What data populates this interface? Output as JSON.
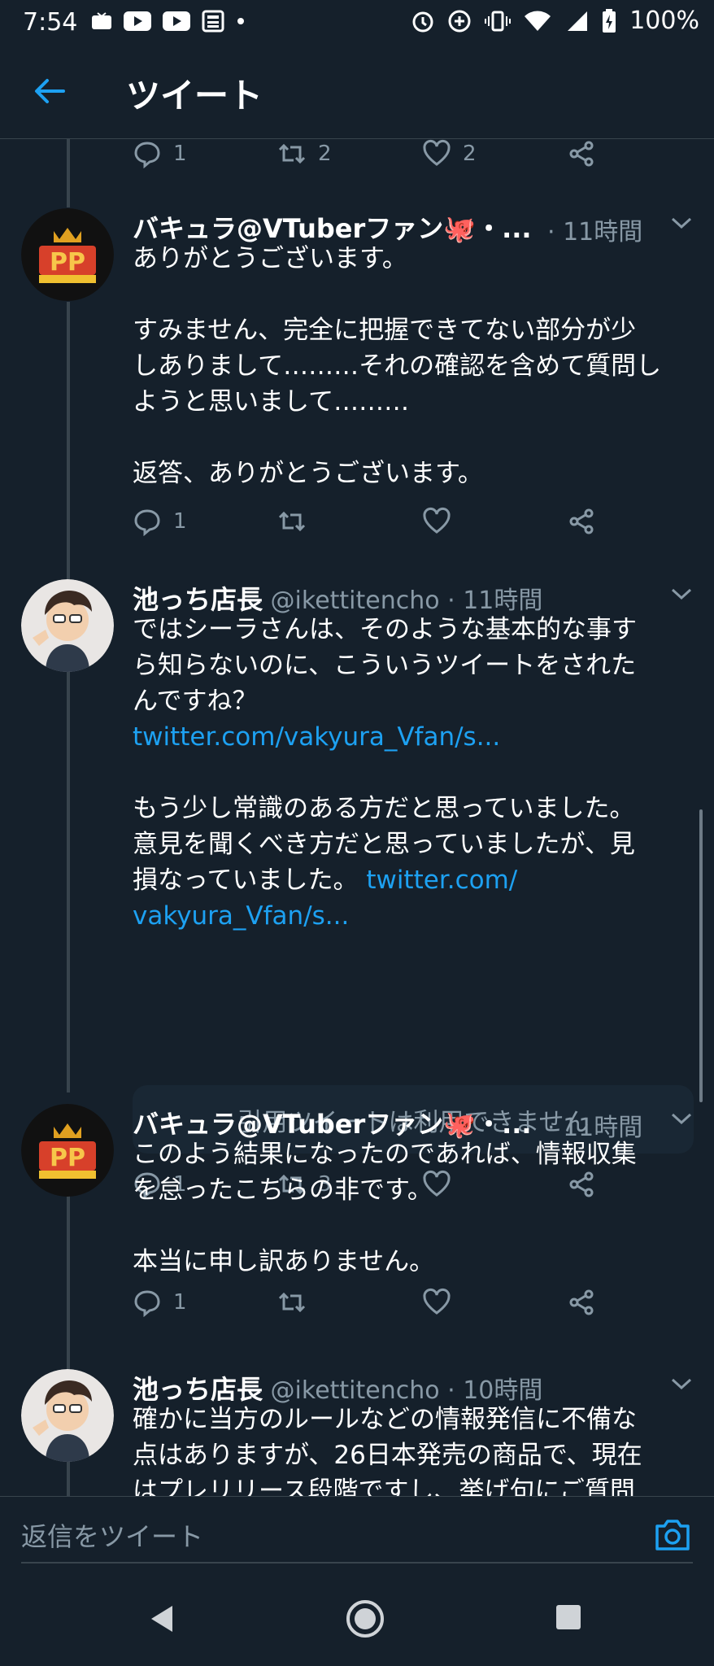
{
  "status_bar": {
    "time": "7:54",
    "battery": "100%",
    "left_icons": [
      "tv-icon",
      "youtube-icon",
      "youtube-icon",
      "news-icon",
      "dot-icon"
    ],
    "right_icons": [
      "alarm-icon",
      "data-saver-icon",
      "vibrate-icon",
      "wifi-icon",
      "signal-icon",
      "battery-icon"
    ]
  },
  "app_bar": {
    "title": "ツイート",
    "back_icon": "arrow-left-icon"
  },
  "colors": {
    "background": "#15202b",
    "accent": "#1da1f2",
    "muted": "#8899a6",
    "divider": "#38444d"
  },
  "top_actions": {
    "reply_count": "1",
    "retweet_count": "2",
    "like_count": "2"
  },
  "tweets": [
    {
      "name": "バキュラ@VTuberファン🐙・...",
      "meta": " · 11時間",
      "lines": [
        "ありがとうございます。",
        "",
        "すみません、完全に把握できてない部分が少",
        "しありまして………それの確認を含めて質問し",
        "ようと思いまして………",
        "",
        "返答、ありがとうございます。"
      ],
      "reply_count": "1",
      "retweet_count": "",
      "like_count": ""
    },
    {
      "name": "池っち店長",
      "meta": " @ikettitencho · 11時間",
      "lines": [
        "ではシーラさんは、そのような基本的な事す",
        "ら知らないのに、こういうツイートをされた",
        "んですね？"
      ],
      "link1": "twitter.com/vakyura_Vfan/s...",
      "lines2": [
        "もう少し常識のある方だと思っていました。",
        "意見を聞くべき方だと思っていましたが、見",
        "損なっていました。"
      ],
      "link2_part1": "twitter.com/",
      "link2_part2": "vakyura_Vfan/s...",
      "quote_unavailable": "引用ツイートは利用できません",
      "reply_count": "1",
      "retweet_count": "3",
      "like_count": ""
    },
    {
      "name": "バキュラ@VTuberファン🐙・...",
      "meta": " · 11時間",
      "lines": [
        "このよう結果になったのであれば、情報収集",
        "を怠ったこちらの非です。",
        "",
        "本当に申し訳ありません。"
      ],
      "reply_count": "1",
      "retweet_count": "",
      "like_count": ""
    },
    {
      "name": "池っち店長",
      "meta": " @ikettitencho · 10時間",
      "lines": [
        "確かに当方のルールなどの情報発信に不備な",
        "点はありますが、26日本発売の商品で、現在",
        "はプレリリース段階ですし、挙げ句にご質問"
      ]
    }
  ],
  "reply_bar": {
    "placeholder": "返信をツイート",
    "camera_icon": "camera-icon"
  },
  "nav_bar": {
    "icons": [
      "back-triangle-icon",
      "home-circle-icon",
      "recents-square-icon"
    ]
  }
}
